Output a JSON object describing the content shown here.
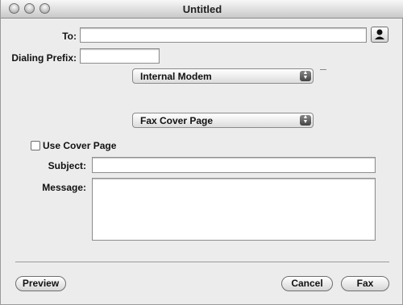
{
  "window": {
    "title": "Untitled"
  },
  "form": {
    "to_label": "To:",
    "to_value": "",
    "dialing_prefix_label": "Dialing Prefix:",
    "dialing_prefix_value": "",
    "modem_selected": "Internal Modem",
    "panel_selected": "Fax Cover Page",
    "use_cover_page_label": "Use Cover Page",
    "use_cover_page_checked": false,
    "subject_label": "Subject:",
    "subject_value": "",
    "message_label": "Message:",
    "message_value": ""
  },
  "buttons": {
    "preview": "Preview",
    "cancel": "Cancel",
    "fax": "Fax"
  },
  "icons": {
    "address_book": "address-book-person-icon",
    "popup_arrows": "updown-arrows-icon"
  }
}
